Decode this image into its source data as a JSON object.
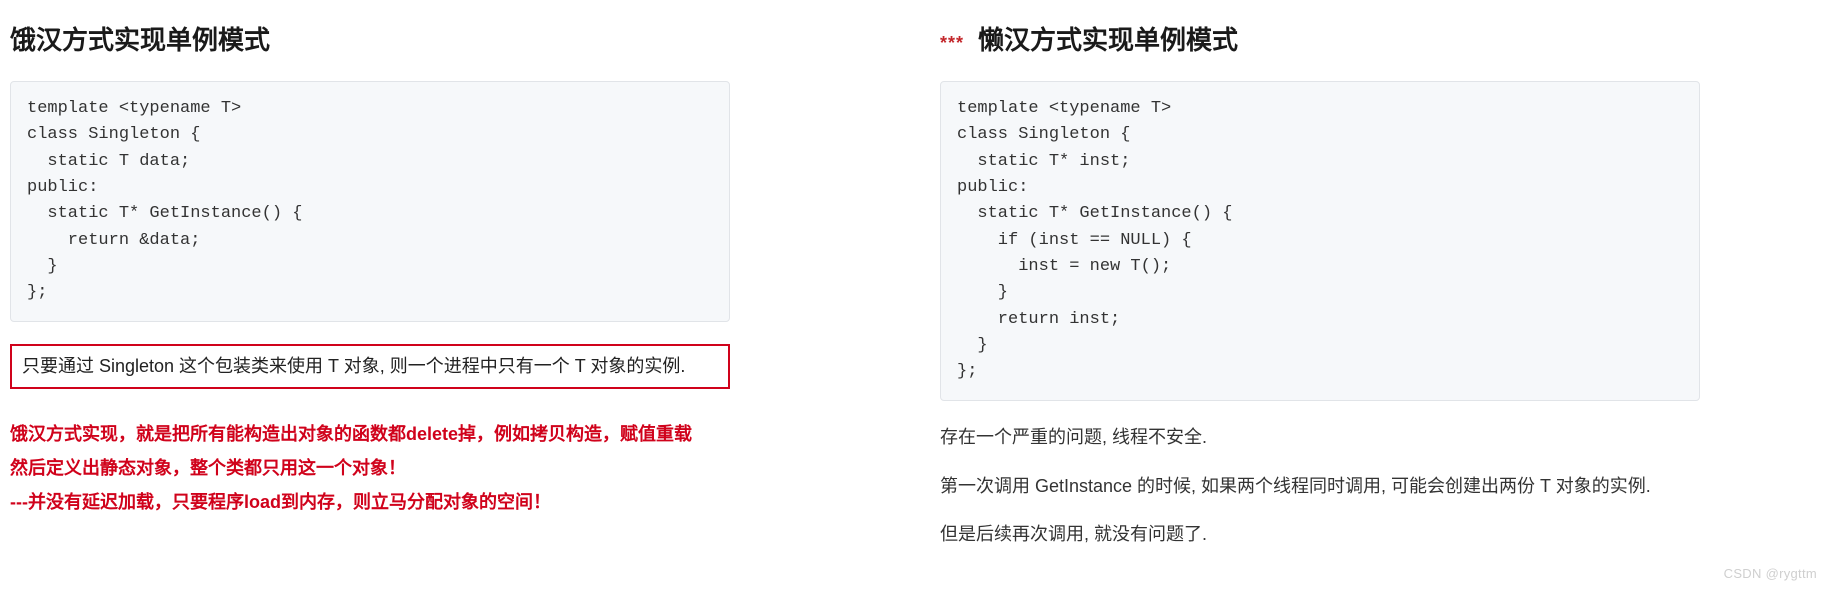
{
  "left": {
    "title": "饿汉方式实现单例模式",
    "code": "template <typename T>\nclass Singleton {\n  static T data;\npublic:\n  static T* GetInstance() {\n    return &data;\n  }\n};",
    "boxed_note": "只要通过 Singleton 这个包装类来使用 T 对象, 则一个进程中只有一个 T 对象的实例.",
    "red_paras": [
      "饿汉方式实现，就是把所有能构造出对象的函数都delete掉，例如拷贝构造，赋值重载",
      "然后定义出静态对象，整个类都只用这一个对象！",
      "---并没有延迟加载，只要程序load到内存，则立马分配对象的空间！"
    ]
  },
  "right": {
    "stars": "***",
    "title": "懒汉方式实现单例模式",
    "code": "template <typename T>\nclass Singleton {\n  static T* inst;\npublic:\n  static T* GetInstance() {\n    if (inst == NULL) {\n      inst = new T();\n    }\n    return inst;\n  }\n};",
    "paras": [
      "存在一个严重的问题, 线程不安全.",
      "第一次调用 GetInstance 的时候, 如果两个线程同时调用, 可能会创建出两份 T 对象的实例.",
      "但是后续再次调用, 就没有问题了."
    ]
  },
  "watermark": "CSDN @rygttm"
}
